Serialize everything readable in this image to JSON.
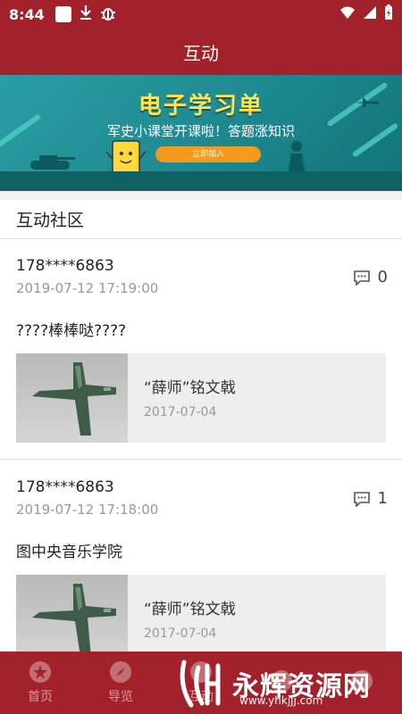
{
  "status_bar": {
    "time": "8:44"
  },
  "app_bar": {
    "title": "互动"
  },
  "banner": {
    "title": "电子学习单",
    "subtitle": "军史小课堂开课啦！答题涨知识",
    "button": "立即加入"
  },
  "section": {
    "title": "互动社区"
  },
  "posts": [
    {
      "user": "178****6863",
      "time": "2019-07-12 17:19:00",
      "comments": "0",
      "text": "????棒棒哒????",
      "card": {
        "title": "“薛师”铭文戟",
        "date": "2017-07-04"
      }
    },
    {
      "user": "178****6863",
      "time": "2019-07-12 17:18:00",
      "comments": "1",
      "text": "图中央音乐学院",
      "card": {
        "title": "“薛师”铭文戟",
        "date": "2017-07-04"
      }
    }
  ],
  "bottom_nav": {
    "items": [
      {
        "label": "首页",
        "icon": "star-badge-icon"
      },
      {
        "label": "导览",
        "icon": "compass-icon"
      },
      {
        "label": "互动",
        "icon": "chat-icon"
      },
      {
        "label": "",
        "icon": "ticket-icon"
      },
      {
        "label": "",
        "icon": "user-icon"
      }
    ]
  },
  "watermark": {
    "text": "永辉资源网",
    "url": "www.yhkjjj.com"
  },
  "colors": {
    "primary": "#a3212b",
    "banner": "#1f8a91",
    "accent": "#ffe352"
  }
}
